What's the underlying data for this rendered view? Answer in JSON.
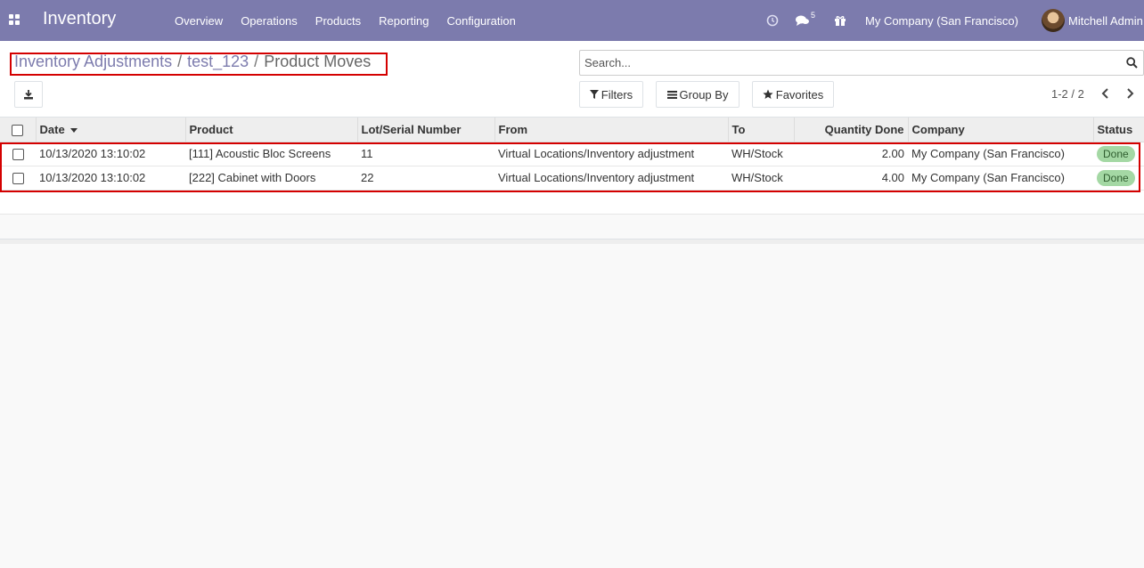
{
  "navbar": {
    "app_name": "Inventory",
    "menu": [
      "Overview",
      "Operations",
      "Products",
      "Reporting",
      "Configuration"
    ],
    "chat_count": "5",
    "company": "My Company (San Francisco)",
    "user": "Mitchell Admin",
    "color": "#7c7bad"
  },
  "breadcrumb": {
    "items": [
      "Inventory Adjustments",
      "test_123"
    ],
    "current": "Product Moves",
    "separator": "/"
  },
  "search": {
    "placeholder": "Search..."
  },
  "filters": {
    "filters_label": "Filters",
    "group_by_label": "Group By",
    "favorites_label": "Favorites"
  },
  "pager": {
    "value": "1-2 / 2"
  },
  "table": {
    "columns": [
      "Date",
      "Product",
      "Lot/Serial Number",
      "From",
      "To",
      "Quantity Done",
      "Company",
      "Status"
    ],
    "rows": [
      {
        "date": "10/13/2020 13:10:02",
        "product": "[111] Acoustic Bloc Screens",
        "lot": "11",
        "from": "Virtual Locations/Inventory adjustment",
        "to": "WH/Stock",
        "qty": "2.00",
        "company": "My Company (San Francisco)",
        "status": "Done"
      },
      {
        "date": "10/13/2020 13:10:02",
        "product": "[222] Cabinet with Doors",
        "lot": "22",
        "from": "Virtual Locations/Inventory adjustment",
        "to": "WH/Stock",
        "qty": "4.00",
        "company": "My Company (San Francisco)",
        "status": "Done"
      }
    ]
  },
  "colors": {
    "status_done_bg": "#a4d8a4",
    "highlight": "#d40000"
  }
}
